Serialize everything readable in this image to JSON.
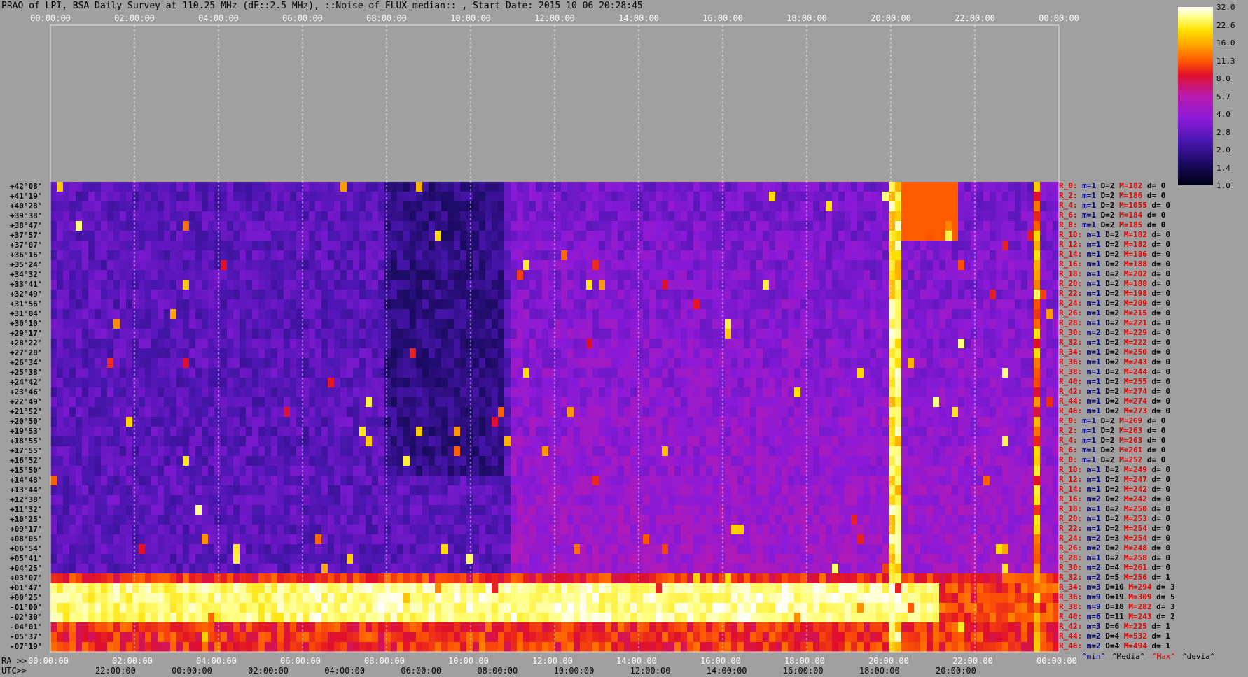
{
  "title": "PRAO of LPI, BSA Daily Survey at 110.25 MHz (dF::2.5 MHz), ::Noise_of_FLUX_median:: , Start Date: 2015 10 06 20:28:45",
  "chart_data": {
    "type": "heatmap",
    "top_axis_ticks": [
      "00:00:00",
      "02:00:00",
      "04:00:00",
      "06:00:00",
      "08:00:00",
      "10:00:00",
      "12:00:00",
      "14:00:00",
      "16:00:00",
      "18:00:00",
      "20:00:00",
      "22:00:00",
      "00:00:00"
    ],
    "ra_axis_label": "RA >>",
    "ra_ticks": [
      "00:00:00",
      "02:00:00",
      "04:00:00",
      "06:00:00",
      "08:00:00",
      "10:00:00",
      "12:00:00",
      "14:00:00",
      "16:00:00",
      "18:00:00",
      "20:00:00",
      "22:00:00",
      "00:00:00"
    ],
    "utc_axis_label": "UTC>>",
    "utc_ticks": [
      "22:00:00",
      "00:00:00",
      "02:00:00",
      "04:00:00",
      "06:00:00",
      "08:00:00",
      "10:00:00",
      "12:00:00",
      "14:00:00",
      "16:00:00",
      "18:00:00",
      "20:00:00"
    ],
    "declinations": [
      "+42°08'",
      "+41°19'",
      "+40°28'",
      "+39°38'",
      "+38°47'",
      "+37°57'",
      "+37°07'",
      "+36°16'",
      "+35°24'",
      "+34°32'",
      "+33°41'",
      "+32°49'",
      "+31°56'",
      "+31°04'",
      "+30°10'",
      "+29°17'",
      "+28°22'",
      "+27°28'",
      "+26°34'",
      "+25°38'",
      "+24°42'",
      "+23°46'",
      "+22°49'",
      "+21°52'",
      "+20°50'",
      "+19°53'",
      "+18°55'",
      "+17°55'",
      "+16°52'",
      "+15°50'",
      "+14°48'",
      "+13°44'",
      "+12°38'",
      "+11°32'",
      "+10°25'",
      "+09°17'",
      "+08°05'",
      "+06°54'",
      "+05°41'",
      "+04°25'",
      "+03°07'",
      "+01°47'",
      "+00°25'",
      "-01°00'",
      "-02°30'",
      "-04°01'",
      "-05°37'",
      "-07°19'"
    ],
    "colorbar_ticks": [
      "32.0",
      "22.6",
      "16.0",
      "11.3",
      "8.0",
      "5.7",
      "4.0",
      "2.8",
      "2.0",
      "1.4",
      "1.0"
    ],
    "right_stats": [
      [
        "R_0:",
        "m=1",
        "D=2",
        "M=182",
        "d= 0"
      ],
      [
        "R_2:",
        "m=1",
        "D=2",
        "M=186",
        "d= 0"
      ],
      [
        "R_4:",
        "m=1",
        "D=2",
        "M=1055",
        "d= 0"
      ],
      [
        "R_6:",
        "m=1",
        "D=2",
        "M=184",
        "d= 0"
      ],
      [
        "R_8:",
        "m=1",
        "D=2",
        "M=185",
        "d= 0"
      ],
      [
        "R_10:",
        "m=1",
        "D=2",
        "M=182",
        "d= 0"
      ],
      [
        "R_12:",
        "m=1",
        "D=2",
        "M=182",
        "d= 0"
      ],
      [
        "R_14:",
        "m=1",
        "D=2",
        "M=186",
        "d= 0"
      ],
      [
        "R_16:",
        "m=1",
        "D=2",
        "M=188",
        "d= 0"
      ],
      [
        "R_18:",
        "m=1",
        "D=2",
        "M=202",
        "d= 0"
      ],
      [
        "R_20:",
        "m=1",
        "D=2",
        "M=188",
        "d= 0"
      ],
      [
        "R_22:",
        "m=1",
        "D=2",
        "M=198",
        "d= 0"
      ],
      [
        "R_24:",
        "m=1",
        "D=2",
        "M=209",
        "d= 0"
      ],
      [
        "R_26:",
        "m=1",
        "D=2",
        "M=215",
        "d= 0"
      ],
      [
        "R_28:",
        "m=1",
        "D=2",
        "M=221",
        "d= 0"
      ],
      [
        "R_30:",
        "m=2",
        "D=2",
        "M=229",
        "d= 0"
      ],
      [
        "R_32:",
        "m=1",
        "D=2",
        "M=222",
        "d= 0"
      ],
      [
        "R_34:",
        "m=1",
        "D=2",
        "M=250",
        "d= 0"
      ],
      [
        "R_36:",
        "m=1",
        "D=2",
        "M=243",
        "d= 0"
      ],
      [
        "R_38:",
        "m=1",
        "D=2",
        "M=244",
        "d= 0"
      ],
      [
        "R_40:",
        "m=1",
        "D=2",
        "M=255",
        "d= 0"
      ],
      [
        "R_42:",
        "m=1",
        "D=2",
        "M=274",
        "d= 0"
      ],
      [
        "R_44:",
        "m=1",
        "D=2",
        "M=274",
        "d= 0"
      ],
      [
        "R_46:",
        "m=1",
        "D=2",
        "M=273",
        "d= 0"
      ],
      [
        "R_0:",
        "m=1",
        "D=2",
        "M=269",
        "d= 0"
      ],
      [
        "R_2:",
        "m=1",
        "D=2",
        "M=263",
        "d= 0"
      ],
      [
        "R_4:",
        "m=1",
        "D=2",
        "M=263",
        "d= 0"
      ],
      [
        "R_6:",
        "m=1",
        "D=2",
        "M=261",
        "d= 0"
      ],
      [
        "R_8:",
        "m=1",
        "D=2",
        "M=252",
        "d= 0"
      ],
      [
        "R_10:",
        "m=1",
        "D=2",
        "M=249",
        "d= 0"
      ],
      [
        "R_12:",
        "m=1",
        "D=2",
        "M=247",
        "d= 0"
      ],
      [
        "R_14:",
        "m=1",
        "D=2",
        "M=242",
        "d= 0"
      ],
      [
        "R_16:",
        "m=2",
        "D=2",
        "M=242",
        "d= 0"
      ],
      [
        "R_18:",
        "m=1",
        "D=2",
        "M=250",
        "d= 0"
      ],
      [
        "R_20:",
        "m=1",
        "D=2",
        "M=253",
        "d= 0"
      ],
      [
        "R_22:",
        "m=1",
        "D=2",
        "M=254",
        "d= 0"
      ],
      [
        "R_24:",
        "m=2",
        "D=3",
        "M=254",
        "d= 0"
      ],
      [
        "R_26:",
        "m=2",
        "D=2",
        "M=248",
        "d= 0"
      ],
      [
        "R_28:",
        "m=1",
        "D=2",
        "M=258",
        "d= 0"
      ],
      [
        "R_30:",
        "m=2",
        "D=4",
        "M=261",
        "d= 0"
      ],
      [
        "R_32:",
        "m=2",
        "D=5",
        "M=256",
        "d= 1"
      ],
      [
        "R_34:",
        "m=3",
        "D=10",
        "M=294",
        "d= 3"
      ],
      [
        "R_36:",
        "m=9",
        "D=19",
        "M=309",
        "d= 5"
      ],
      [
        "R_38:",
        "m=9",
        "D=18",
        "M=282",
        "d= 3"
      ],
      [
        "R_40:",
        "m=6",
        "D=11",
        "M=243",
        "d= 2"
      ],
      [
        "R_42:",
        "m=3",
        "D=6",
        "M=225",
        "d= 1"
      ],
      [
        "R_44:",
        "m=2",
        "D=4",
        "M=532",
        "d= 1"
      ],
      [
        "R_46:",
        "m=2",
        "D=4",
        "M=494",
        "d= 1"
      ]
    ],
    "stats_legend": [
      "^min^",
      "^Media^",
      "^Max^",
      "^devia^"
    ]
  },
  "colors": {
    "background": "#a0a0a0",
    "stat_blue": "#000080",
    "stat_red": "#e00000",
    "row_index_red": "#c00000"
  }
}
